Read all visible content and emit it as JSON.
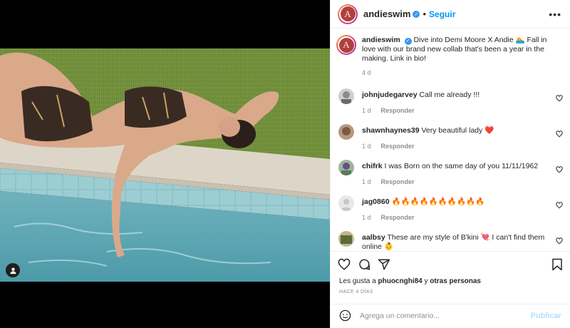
{
  "post": {
    "account": "andieswim",
    "follow_label": "Seguir",
    "separator": "•",
    "more_label": "•••",
    "avatar_letter": "A",
    "caption_text": "Dive into Demi Moore X Andie 🏊 Fall in love with our brand new collab that's been a year in the making. Link in bio!",
    "caption_age": "4 d"
  },
  "comments": [
    {
      "user": "johnjudegarvey",
      "text": "Call me already !!!",
      "age": "1 d",
      "reply": "Responder"
    },
    {
      "user": "shawnhaynes39",
      "text": "Very beautiful lady ❤️",
      "age": "1 d",
      "reply": "Responder"
    },
    {
      "user": "chifrk",
      "text": "I was Born on the same day of you 11/11/1962",
      "age": "1 d",
      "reply": "Responder"
    },
    {
      "user": "jag0860",
      "text": "🔥🔥🔥🔥🔥🔥🔥🔥🔥🔥",
      "age": "1 d",
      "reply": "Responder"
    },
    {
      "user": "aalbsy",
      "text": "These are my style of B'kini 💘 I can't find them online 👶",
      "age": "",
      "reply": ""
    }
  ],
  "likes": {
    "prefix": "Les gusta a",
    "user": "phuocnghi84",
    "joiner": "y",
    "others": "otras personas"
  },
  "timestamp": "HACE 4 DÍAS",
  "composer": {
    "placeholder": "Agrega un comentario...",
    "post_label": "Publicar"
  },
  "icons": [
    "verified-icon",
    "more-options-icon",
    "heart-icon",
    "comment-icon",
    "share-icon",
    "save-icon",
    "emoji-icon",
    "tag-user-icon"
  ],
  "colors": {
    "accent": "#0095f6",
    "verified": "#3897f0",
    "muted": "#8e8e8e",
    "post_disabled": "#b2dffc"
  }
}
